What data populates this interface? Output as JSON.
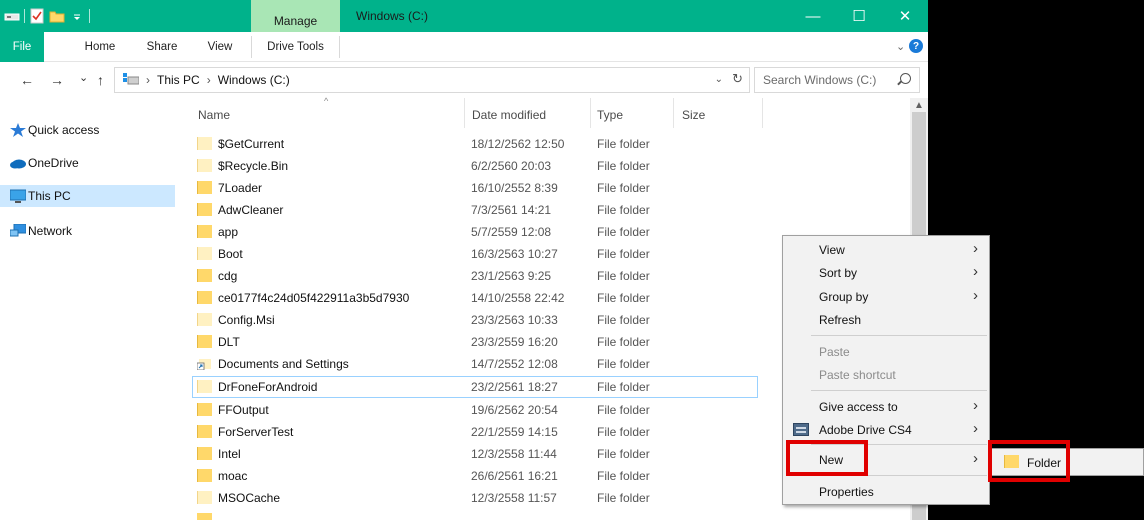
{
  "window": {
    "title": "Windows (C:)",
    "contextual_tab": "Manage",
    "controls": {
      "minimize": "—",
      "maximize": "☐",
      "close": "✕"
    },
    "accent_color": "#00b28b"
  },
  "ribbon": {
    "tabs": [
      "File",
      "Home",
      "Share",
      "View",
      "Drive Tools"
    ]
  },
  "address": {
    "back": "←",
    "forward": "→",
    "recent": "⌄",
    "up": "↑",
    "path": [
      "This PC",
      "Windows (C:)"
    ],
    "path_separator": "›",
    "dropdown": "⌄",
    "refresh": "↻",
    "search_placeholder": "Search Windows (C:)"
  },
  "nav": {
    "items": [
      {
        "label": "Quick access",
        "icon": "star-icon"
      },
      {
        "label": "OneDrive",
        "icon": "cloud-icon"
      },
      {
        "label": "This PC",
        "icon": "monitor-icon",
        "selected": true
      },
      {
        "label": "Network",
        "icon": "network-icon"
      }
    ]
  },
  "list": {
    "columns": [
      "Name",
      "Date modified",
      "Type",
      "Size"
    ],
    "sort_arrow": "^",
    "rows": [
      {
        "name": "$GetCurrent",
        "date": "18/12/2562 12:50",
        "type": "File folder"
      },
      {
        "name": "$Recycle.Bin",
        "date": "6/2/2560 20:03",
        "type": "File folder"
      },
      {
        "name": "7Loader",
        "date": "16/10/2552 8:39",
        "type": "File folder"
      },
      {
        "name": "AdwCleaner",
        "date": "7/3/2561 14:21",
        "type": "File folder"
      },
      {
        "name": "app",
        "date": "5/7/2559 12:08",
        "type": "File folder"
      },
      {
        "name": "Boot",
        "date": "16/3/2563 10:27",
        "type": "File folder"
      },
      {
        "name": "cdg",
        "date": "23/1/2563 9:25",
        "type": "File folder"
      },
      {
        "name": "ce0177f4c24d05f422911a3b5d7930",
        "date": "14/10/2558 22:42",
        "type": "File folder"
      },
      {
        "name": "Config.Msi",
        "date": "23/3/2563 10:33",
        "type": "File folder"
      },
      {
        "name": "DLT",
        "date": "23/3/2559 16:20",
        "type": "File folder"
      },
      {
        "name": "Documents and Settings",
        "date": "14/7/2552 12:08",
        "type": "File folder",
        "shortcut": true
      },
      {
        "name": "DrFoneForAndroid",
        "date": "23/2/2561 18:27",
        "type": "File folder",
        "highlighted": true
      },
      {
        "name": "FFOutput",
        "date": "19/6/2562 20:54",
        "type": "File folder"
      },
      {
        "name": "ForServerTest",
        "date": "22/1/2559 14:15",
        "type": "File folder"
      },
      {
        "name": "Intel",
        "date": "12/3/2558 11:44",
        "type": "File folder"
      },
      {
        "name": "moac",
        "date": "26/6/2561 16:21",
        "type": "File folder"
      },
      {
        "name": "MSOCache",
        "date": "12/3/2558 11:57",
        "type": "File folder"
      }
    ]
  },
  "context_menu": {
    "items": [
      {
        "label": "View",
        "submenu": true
      },
      {
        "label": "Sort by",
        "submenu": true
      },
      {
        "label": "Group by",
        "submenu": true
      },
      {
        "label": "Refresh"
      },
      {
        "label": "Paste",
        "disabled": true
      },
      {
        "label": "Paste shortcut",
        "disabled": true
      },
      {
        "label": "Give access to",
        "submenu": true
      },
      {
        "label": "Adobe Drive CS4",
        "submenu": true,
        "icon": "adobe-drive-icon"
      },
      {
        "label": "New",
        "submenu": true,
        "highlighted": true
      },
      {
        "label": "Properties"
      }
    ],
    "arrow": "›"
  },
  "submenu": {
    "items": [
      {
        "label": "Folder",
        "icon": "folder-icon",
        "highlighted": true
      }
    ]
  },
  "colors": {
    "folder": "#ffd86a",
    "selection": "#cce8ff",
    "highlight_box": "#e00000"
  }
}
